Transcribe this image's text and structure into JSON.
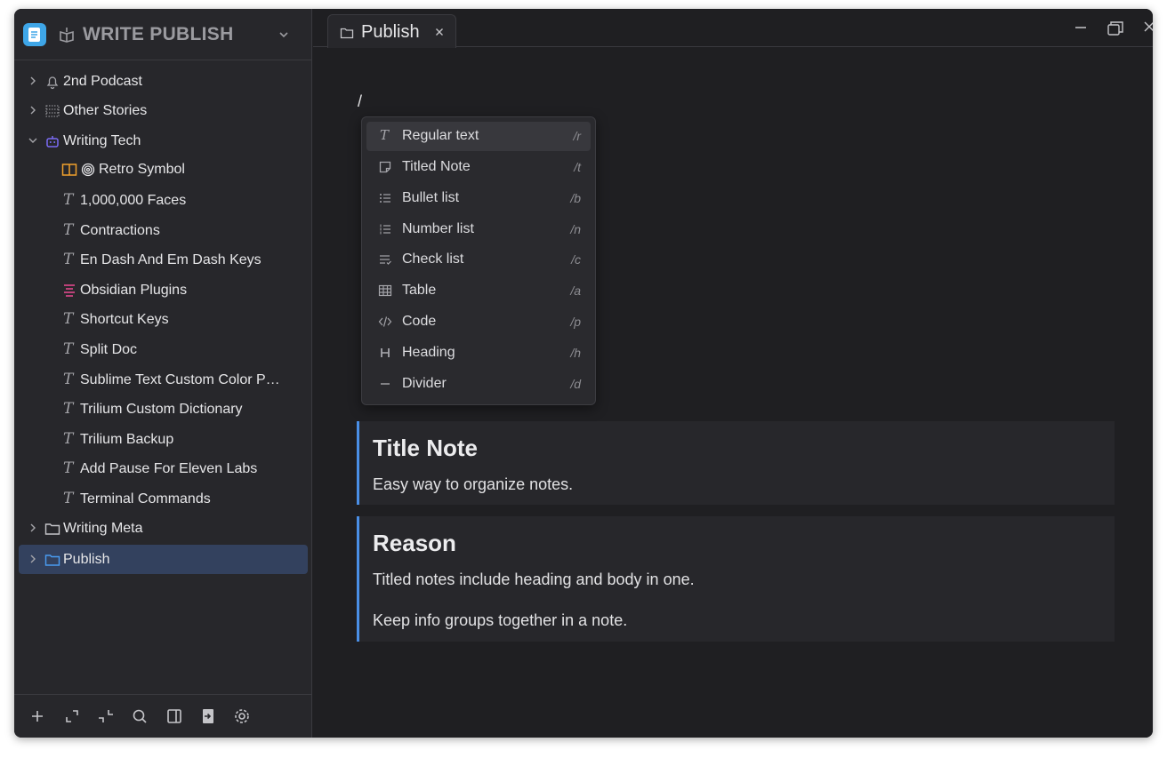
{
  "workspace": {
    "title": "WRITE PUBLISH"
  },
  "tree": {
    "items": [
      {
        "label": "2nd Podcast"
      },
      {
        "label": "Other Stories"
      },
      {
        "label": "Writing Tech"
      },
      {
        "label": "Retro Symbol",
        "prefix": "◎"
      },
      {
        "label": "1,000,000 Faces"
      },
      {
        "label": "Contractions"
      },
      {
        "label": "En Dash And Em Dash Keys"
      },
      {
        "label": "Obsidian Plugins"
      },
      {
        "label": "Shortcut Keys"
      },
      {
        "label": "Split Doc"
      },
      {
        "label": "Sublime Text Custom Color P…"
      },
      {
        "label": "Trilium Custom Dictionary"
      },
      {
        "label": "Trilium Backup"
      },
      {
        "label": "Add Pause For Eleven Labs"
      },
      {
        "label": "Terminal Commands"
      },
      {
        "label": "Writing Meta"
      },
      {
        "label": "Publish"
      }
    ],
    "text_icon_glyph": "T"
  },
  "tab": {
    "label": "Publish"
  },
  "editor": {
    "slash": "/",
    "menu": [
      {
        "label": "Regular text",
        "shortcut": "/r"
      },
      {
        "label": "Titled Note",
        "shortcut": "/t"
      },
      {
        "label": "Bullet list",
        "shortcut": "/b"
      },
      {
        "label": "Number list",
        "shortcut": "/n"
      },
      {
        "label": "Check list",
        "shortcut": "/c"
      },
      {
        "label": "Table",
        "shortcut": "/a"
      },
      {
        "label": "Code",
        "shortcut": "/p"
      },
      {
        "label": "Heading",
        "shortcut": "/h"
      },
      {
        "label": "Divider",
        "shortcut": "/d"
      }
    ],
    "blocks": [
      {
        "title": "Title Note",
        "body": [
          "Easy way to organize notes."
        ]
      },
      {
        "title": "Reason",
        "body": [
          "Titled notes include heading and body in one.",
          "Keep info groups together in a note."
        ]
      }
    ]
  },
  "colors": {
    "accent": "#4a8fe7",
    "selected_row": "#33415e",
    "app_icon": "#3ea6e8",
    "writing_tech_icon": "#7b6cf6",
    "book_icon": "#f0a02c",
    "plugins_icon": "#e0488c"
  }
}
